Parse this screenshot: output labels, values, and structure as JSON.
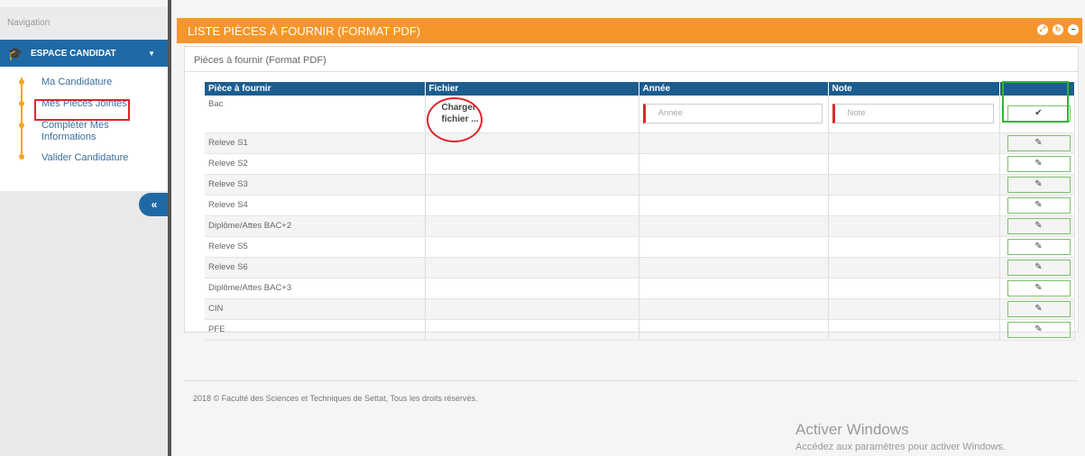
{
  "sidebar": {
    "nav_title": "Navigation",
    "espace": "ESPACE CANDIDAT",
    "items": [
      {
        "label": "Ma Candidature"
      },
      {
        "label": "Mes Pièces Jointes"
      },
      {
        "label": "Compléter Mes Informations"
      },
      {
        "label": "Valider Candidature"
      }
    ],
    "collapse": "«"
  },
  "panel": {
    "title": "LISTE PIÈCES À FOURNIR (FORMAT PDF)",
    "subtitle": "Pièces à fournir (Format PDF)"
  },
  "table": {
    "headers": [
      "Pièce à fournir",
      "Fichier",
      "Année",
      "Note",
      ""
    ],
    "rows": [
      {
        "piece": "Bac",
        "fichier": "Charger fichier ...",
        "annee_placeholder": "Annee",
        "note_placeholder": "Note",
        "action": "✔"
      },
      {
        "piece": "Releve S1",
        "action": "✎"
      },
      {
        "piece": "Releve S2",
        "action": "✎"
      },
      {
        "piece": "Releve S3",
        "action": "✎"
      },
      {
        "piece": "Releve S4",
        "action": "✎"
      },
      {
        "piece": "Diplôme/Attes BAC+2",
        "action": "✎"
      },
      {
        "piece": "Releve S5",
        "action": "✎"
      },
      {
        "piece": "Releve S6",
        "action": "✎"
      },
      {
        "piece": "Diplôme/Attes BAC+3",
        "action": "✎"
      },
      {
        "piece": "CIN",
        "action": "✎"
      },
      {
        "piece": "PFE",
        "action": "✎"
      }
    ]
  },
  "footer": "2018 © Faculté des Sciences et Techniques de Settat, Tous les droits réservés.",
  "watermark": {
    "title": "Activer Windows",
    "subtitle": "Accédez aux paramètres pour activer Windows."
  },
  "colors": {
    "accent": "#f6962a",
    "primary": "#1c5d8f",
    "danger": "#e0242c",
    "success": "#32b432"
  },
  "icons": [
    "graduation-cap-icon",
    "caret-down-icon",
    "pencil-icon",
    "check-icon"
  ]
}
